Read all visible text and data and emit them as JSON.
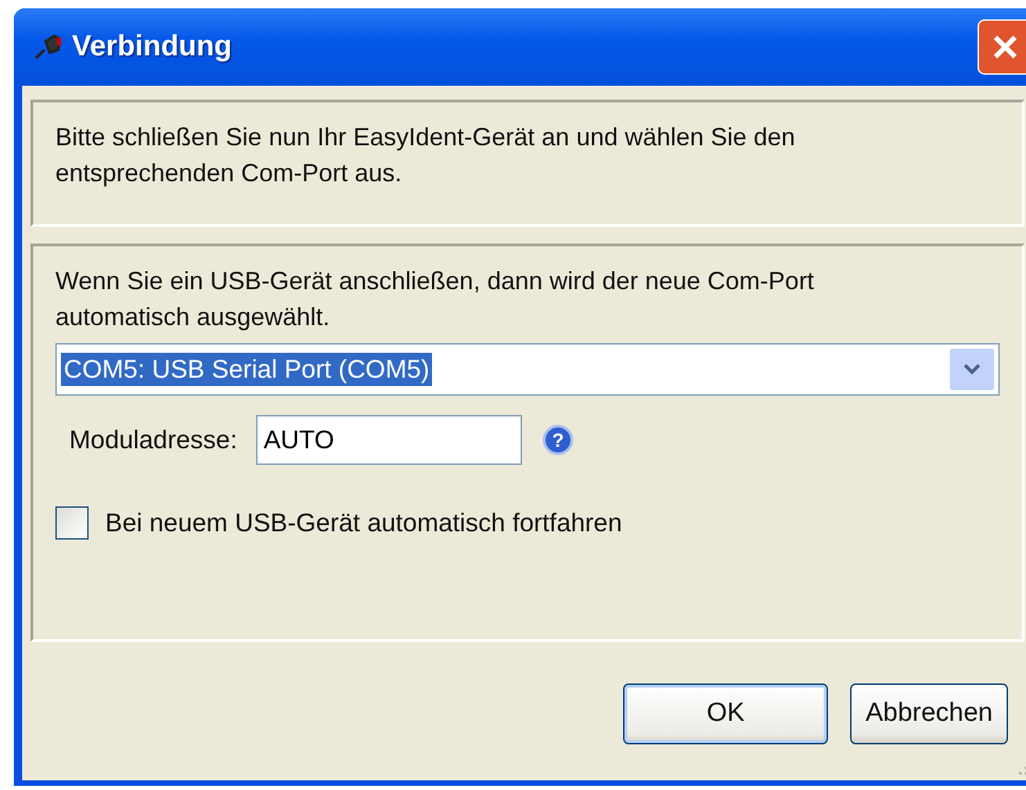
{
  "window": {
    "title": "Verbindung"
  },
  "intro": "Bitte schließen Sie nun Ihr EasyIdent-Gerät an und wählen Sie den entsprechenden Com-Port aus.",
  "port_panel": {
    "hint": "Wenn Sie ein USB-Gerät anschließen, dann wird der neue Com-Port automatisch ausgewählt.",
    "port_select": {
      "value": "COM5: USB Serial Port (COM5)"
    },
    "address": {
      "label": "Moduladresse:",
      "value": "AUTO",
      "help": "?"
    },
    "auto_continue": {
      "label": "Bei neuem USB-Gerät automatisch fortfahren",
      "checked": false
    }
  },
  "buttons": [
    {
      "label": "OK",
      "default": true
    },
    {
      "label": "Abbrechen",
      "default": false
    }
  ]
}
